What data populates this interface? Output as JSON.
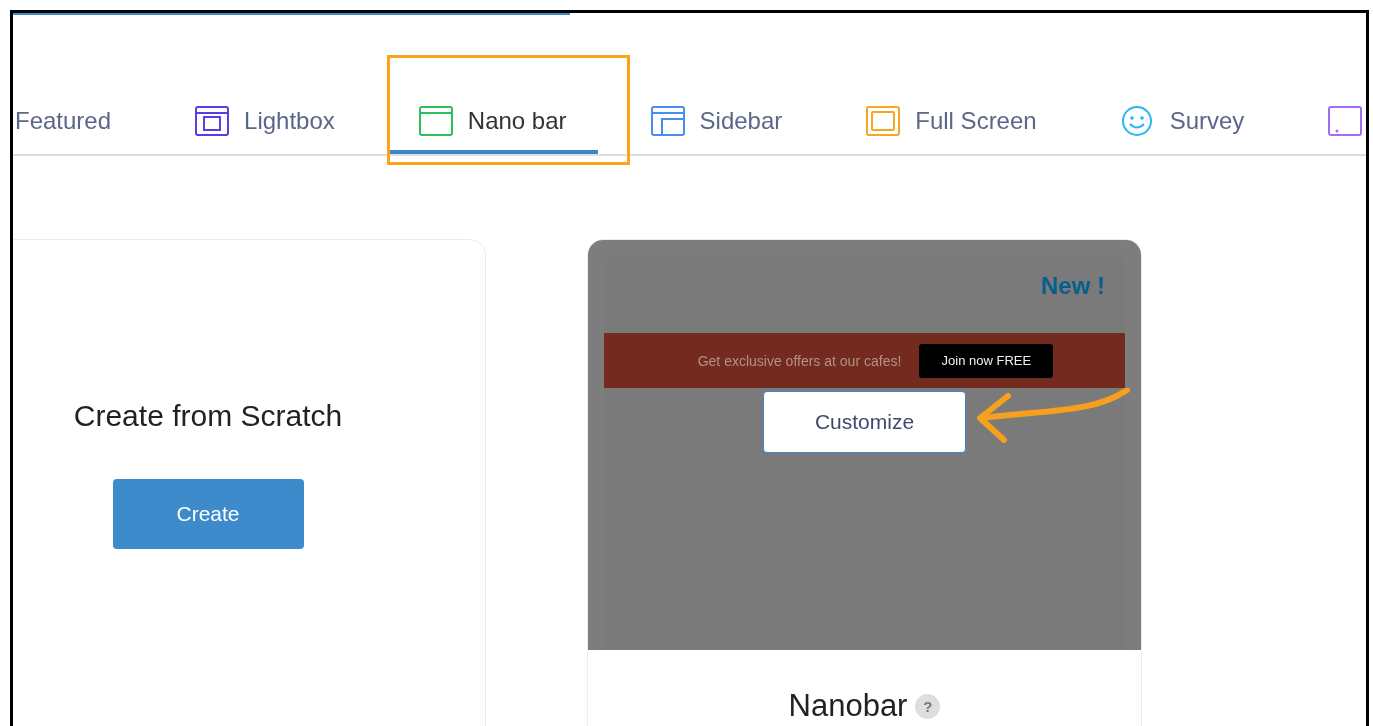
{
  "tabs": [
    {
      "kind": "plain",
      "label": "Featured",
      "selected": false
    },
    {
      "kind": "lightbox",
      "label": "Lightbox",
      "selected": false
    },
    {
      "kind": "nanobar",
      "label": "Nano bar",
      "selected": true
    },
    {
      "kind": "sidebar",
      "label": "Sidebar",
      "selected": false
    },
    {
      "kind": "fullscreen",
      "label": "Full Screen",
      "selected": false
    },
    {
      "kind": "survey",
      "label": "Survey",
      "selected": false
    },
    {
      "kind": "popup",
      "selected": false
    }
  ],
  "scratch_card": {
    "title": "Create from Scratch",
    "button": "Create"
  },
  "template_card": {
    "badge": "New !",
    "bar_text": "Get exclusive offers at our cafes!",
    "bar_button": "Join now FREE",
    "customize_button": "Customize",
    "title": "Nanobar",
    "help": "?"
  }
}
